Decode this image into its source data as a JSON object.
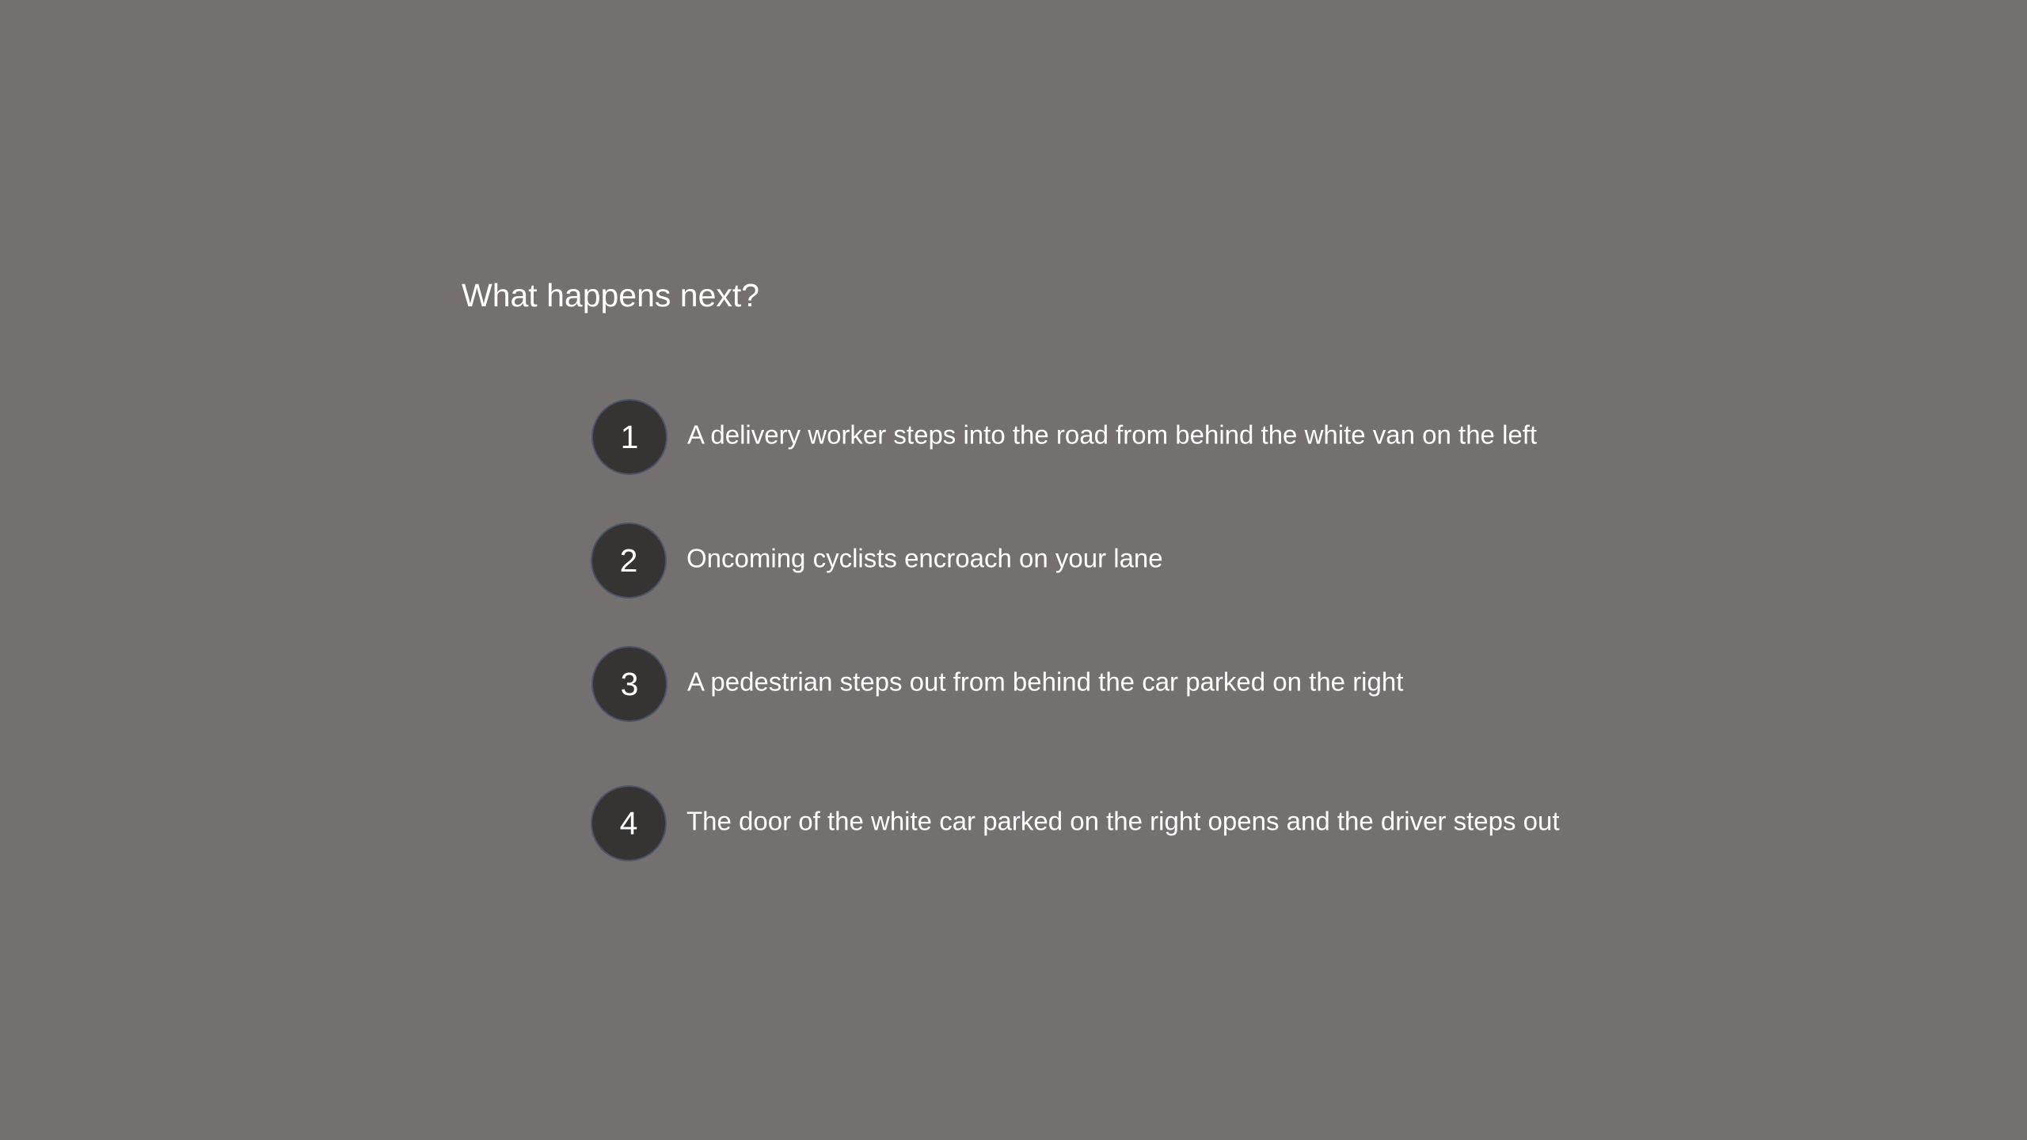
{
  "question": "What happens next?",
  "options": [
    {
      "number": "1",
      "text": "A delivery worker steps into the road from behind the white van on the left"
    },
    {
      "number": "2",
      "text": "Oncoming cyclists encroach on your lane"
    },
    {
      "number": "3",
      "text": "A pedestrian steps out from behind the car parked on the right"
    },
    {
      "number": "4",
      "text": "The door of the white car parked on the right opens and the driver steps out"
    }
  ],
  "colors": {
    "background": "#757070",
    "badge_fill": "#363333",
    "badge_border": "#4d5468",
    "text": "#ffffff"
  }
}
